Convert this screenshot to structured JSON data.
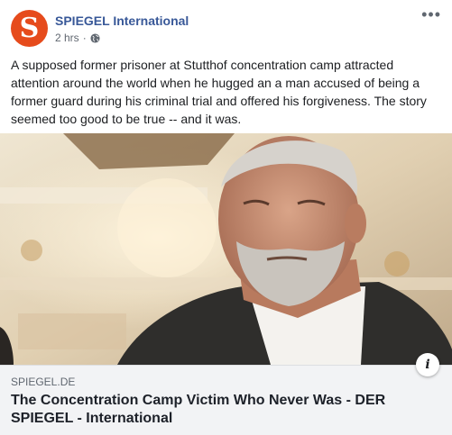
{
  "post": {
    "page_name": "SPIEGEL International",
    "avatar_letter": "S",
    "timestamp": "2 hrs",
    "separator": "·",
    "privacy_icon": "globe-icon",
    "more_icon": "more-options-icon",
    "more_glyph": "•••",
    "text": "A supposed former prisoner at Stutthof concentration camp attracted attention around the world when he hugged an a man accused of being a former guard during his criminal trial and offered his forgiveness. The story seemed too good to be true -- and it was."
  },
  "link_preview": {
    "domain": "SPIEGEL.DE",
    "headline": "The Concentration Camp Victim Who Never Was - DER SPIEGEL - International",
    "info_icon": "info-icon",
    "info_glyph": "i"
  },
  "colors": {
    "brand": "#e64b1c",
    "page_name": "#385898",
    "link_box_bg": "#f2f3f5"
  }
}
